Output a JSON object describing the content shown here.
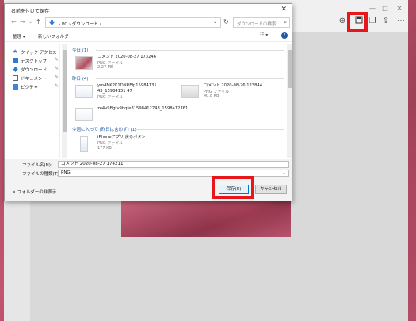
{
  "viewer": {
    "toolbar": {
      "zoom_icon": "zoom-in-icon",
      "save_icon": "save-icon",
      "copy_icon": "copy-icon",
      "share_icon": "share-icon",
      "more_icon": "more-icon"
    },
    "window_controls": {
      "minimize": "—",
      "maximize": "□",
      "close": "✕"
    }
  },
  "dialog": {
    "title": "名前を付けて保存",
    "close": "✕",
    "nav": {
      "back": "←",
      "forward": "→",
      "up_chev": "⌄",
      "up": "↑",
      "refresh": "↻"
    },
    "address": {
      "path": "›  PC  ›  ダウンロード  ›",
      "chevron": "⌄"
    },
    "search": {
      "placeholder": "ダウンロードの検索",
      "icon": "⌕"
    },
    "commands": {
      "organize": "整理 ▾",
      "new_folder": "新しいフォルダー",
      "view_icon": "☷ ▾",
      "help_icon": "?"
    },
    "nav_pane": {
      "items": [
        {
          "label": "クイック アクセス",
          "pin": ""
        },
        {
          "label": "デスクトップ",
          "pin": "✎"
        },
        {
          "label": "ダウンロード",
          "pin": "✎"
        },
        {
          "label": "ドキュメント",
          "pin": "✎"
        },
        {
          "label": "ピクチャ",
          "pin": "✎"
        }
      ]
    },
    "groups": [
      {
        "label": "今日 (1)"
      },
      {
        "label": "昨日 (4)"
      },
      {
        "label": "今週に入って (昨日は含めず) (1)"
      }
    ],
    "files": [
      {
        "name": "コメント 2020-08-27 173246",
        "type": "PNG ファイル",
        "size": "2.27 MB"
      },
      {
        "name": "ym4NK2K1DNREIp15984131 43_15984131 47",
        "type": "PNG ファイル",
        "size": ""
      },
      {
        "name": "コメント 2020-08-26 123844",
        "type": "PNG ファイル",
        "size": "40.8 KB"
      },
      {
        "name": "ze4v9Bgtv9bqfe31598412748_1598412761",
        "type": "PNG ファイル",
        "size": ""
      },
      {
        "name": "iPhoneアプリ 戻るボタン",
        "type": "PNG ファイル",
        "size": "177 KB"
      }
    ],
    "form": {
      "filename_label": "ファイル名(N):",
      "filename_value": "コメント 2020-08-27 174211",
      "type_label": "ファイルの種類(T):",
      "type_value": "PNG",
      "hide_folders": "∧  フォルダーの非表示",
      "save": "保存(S)",
      "cancel": "キャンセル"
    }
  },
  "colors": {
    "highlight": "#e8151b",
    "link_blue": "#1e5aa8"
  }
}
